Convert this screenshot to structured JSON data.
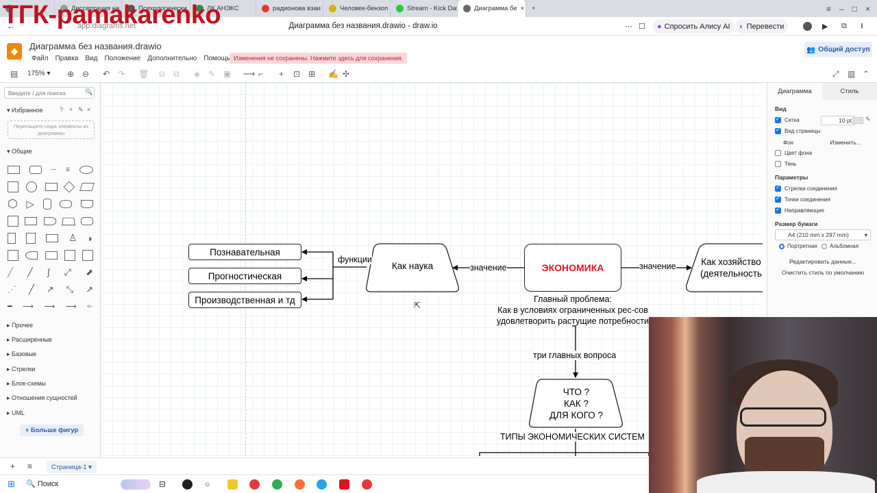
{
  "overlay_text": "ТГК-pamakarenko",
  "browser": {
    "tabs": [
      {
        "label": "Диссертация на"
      },
      {
        "label": "Психологически"
      },
      {
        "label": "ЛК АНЭКС"
      },
      {
        "label": "радионова взаи"
      },
      {
        "label": "Человек-бензоп"
      },
      {
        "label": "Stream - Kick Das"
      },
      {
        "label": "Диаграмма бе"
      }
    ],
    "url": "app.diagrams.net",
    "page_title": "Диаграмма без названия.drawio - draw.io",
    "alice_label": "Спросить Алису AI",
    "translate_label": "Перевести"
  },
  "app": {
    "title": "Диаграмма без названия.drawio",
    "menu": [
      "Файл",
      "Правка",
      "Вид",
      "Положение",
      "Дополнительно",
      "Помощь"
    ],
    "unsaved_notice": "Изменения не сохранены. Нажмите здесь для сохранения.",
    "share_label": "Общий доступ",
    "zoom": "175%"
  },
  "left_panel": {
    "search_placeholder": "Введите / для поиска",
    "favorites_label": "Избранное",
    "favorites_drop": "Перетащите сюда элементы из диаграммы",
    "general_label": "Общие",
    "sections": [
      "Прочее",
      "Расширенные",
      "Базовые",
      "Стрелки",
      "Блок-схемы",
      "Отношения сущностей",
      "UML"
    ],
    "more_shapes": "Больше фигур"
  },
  "diagram": {
    "node_cognitive": "Познавательная",
    "node_prognostic": "Прогностическая",
    "node_production": "Производственная и тд",
    "node_science": "Как наука",
    "node_economy": "ЭКОНОМИКА",
    "node_economy_color": "#e0141e",
    "node_household": "Как хозяйство (деятельность",
    "node_questions": "ЧТО ?\nКАК ?\nДЛЯ КОГО ?",
    "label_functions": "функции",
    "label_meaning_left": "значение",
    "label_meaning_right": "значение",
    "label_main_problem": "Главный проблема:\nКак в условиях ограниченных рес-сов\nудовлетворить растущие потребности",
    "label_three_questions": "три главных вопроса",
    "label_systems": "ТИПЫ ЭКОНОМИЧЕСКИХ СИСТЕМ"
  },
  "right_panel": {
    "tab_diagram": "Диаграмма",
    "tab_style": "Стиль",
    "view_label": "Вид",
    "grid_label": "Сетка",
    "grid_checked": true,
    "grid_size": "10 pt",
    "page_view_label": "Вид страницы",
    "page_view_checked": true,
    "background_label": "Фон",
    "background_button": "Изменить...",
    "bg_color_label": "Цвет фона",
    "bg_color_checked": false,
    "shadow_label": "Тень",
    "shadow_checked": false,
    "options_label": "Параметры",
    "connection_arrows_label": "Стрелки соединения",
    "connection_arrows_checked": true,
    "connection_points_label": "Точки соединения",
    "connection_points_checked": true,
    "guides_label": "Направляющие",
    "guides_checked": true,
    "paper_size_label": "Размер бумаги",
    "paper_size_value": "A4 (210 mm x 297 mm)",
    "portrait_label": "Портретная",
    "landscape_label": "Альбомная",
    "orientation": "portrait",
    "edit_data_button": "Редактировать данные...",
    "clear_style_button": "Очистить стиль по умолчанию"
  },
  "bottom": {
    "page_tab": "Страница-1"
  },
  "taskbar": {
    "search_label": "Поиск"
  }
}
